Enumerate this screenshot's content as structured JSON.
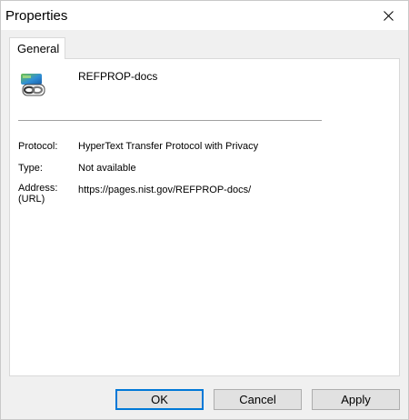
{
  "window": {
    "title": "Properties",
    "close_icon": "close-icon"
  },
  "tabs": [
    {
      "label": "General",
      "selected": true
    }
  ],
  "general": {
    "icon": "internet-shortcut-link-icon",
    "name": "REFPROP-docs",
    "properties": [
      {
        "label": "Protocol:",
        "value": "HyperText Transfer Protocol with Privacy"
      },
      {
        "label": "Type:",
        "value": "Not available"
      },
      {
        "label": "Address:",
        "label2": "(URL)",
        "value": "https://pages.nist.gov/REFPROP-docs/"
      }
    ]
  },
  "buttons": {
    "ok": "OK",
    "cancel": "Cancel",
    "apply": "Apply"
  },
  "colors": {
    "dialog_background": "#f0f0f0",
    "panel_background": "#ffffff",
    "default_button_border": "#0078d7"
  }
}
